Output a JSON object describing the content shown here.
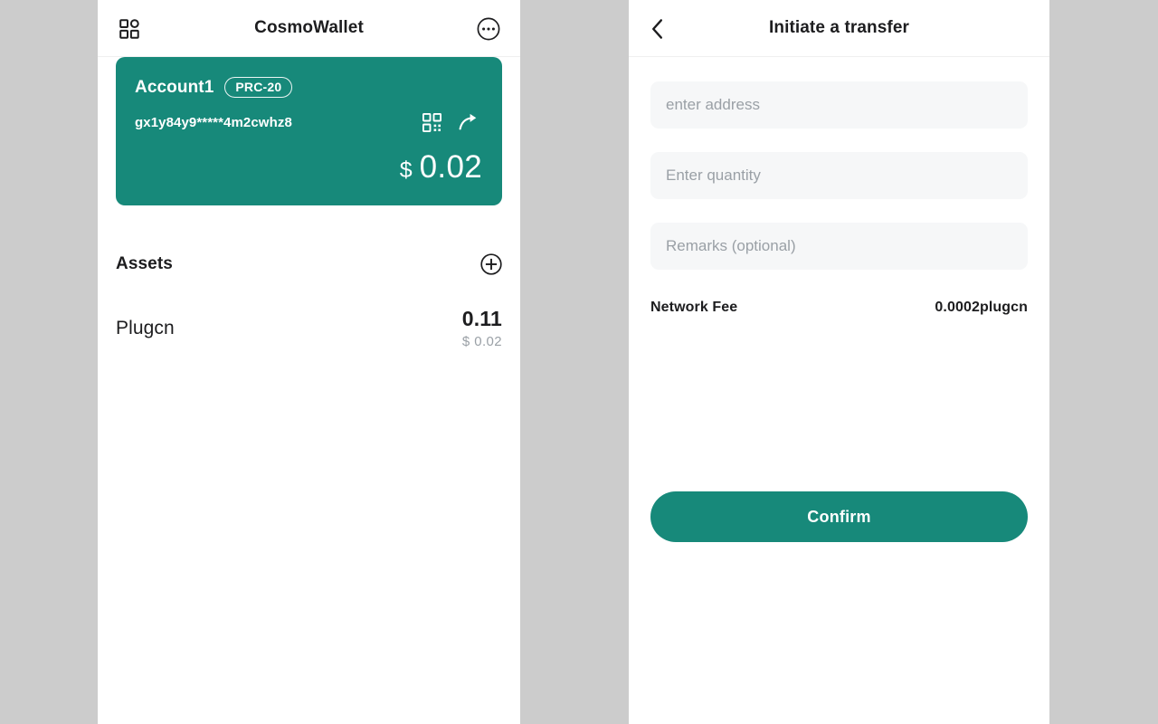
{
  "theme": {
    "accent": "#17897a",
    "page_background": "#cccccc",
    "panel_background": "#ffffff",
    "field_background": "#f6f7f8",
    "text_primary": "#1d1d1f",
    "text_muted": "#9aa0a6"
  },
  "wallet_panel": {
    "appbar": {
      "title": "CosmoWallet",
      "grid_icon": "grid-apps-icon",
      "more_icon": "more-options-icon"
    },
    "account_card": {
      "name": "Account1",
      "badge": "PRC-20",
      "address": "gx1y84y9*****4m2cwhz8",
      "qr_icon": "qr-code-icon",
      "share_icon": "share-arrow-icon",
      "balance_currency": "$",
      "balance_amount": "0.02"
    },
    "assets": {
      "title": "Assets",
      "add_icon": "circle-plus-icon",
      "items": [
        {
          "name": "Plugcn",
          "amount": "0.11",
          "fiat_currency": "$",
          "fiat_value": "0.02"
        }
      ]
    }
  },
  "transfer_panel": {
    "appbar": {
      "title": "Initiate a transfer",
      "back_icon": "chevron-left-icon"
    },
    "fields": {
      "address": {
        "value": "",
        "placeholder": "enter address"
      },
      "quantity": {
        "value": "",
        "placeholder": "Enter quantity"
      },
      "remarks": {
        "value": "",
        "placeholder": "Remarks (optional)"
      }
    },
    "network_fee": {
      "label": "Network Fee",
      "value": "0.0002plugcn"
    },
    "confirm_label": "Confirm"
  }
}
